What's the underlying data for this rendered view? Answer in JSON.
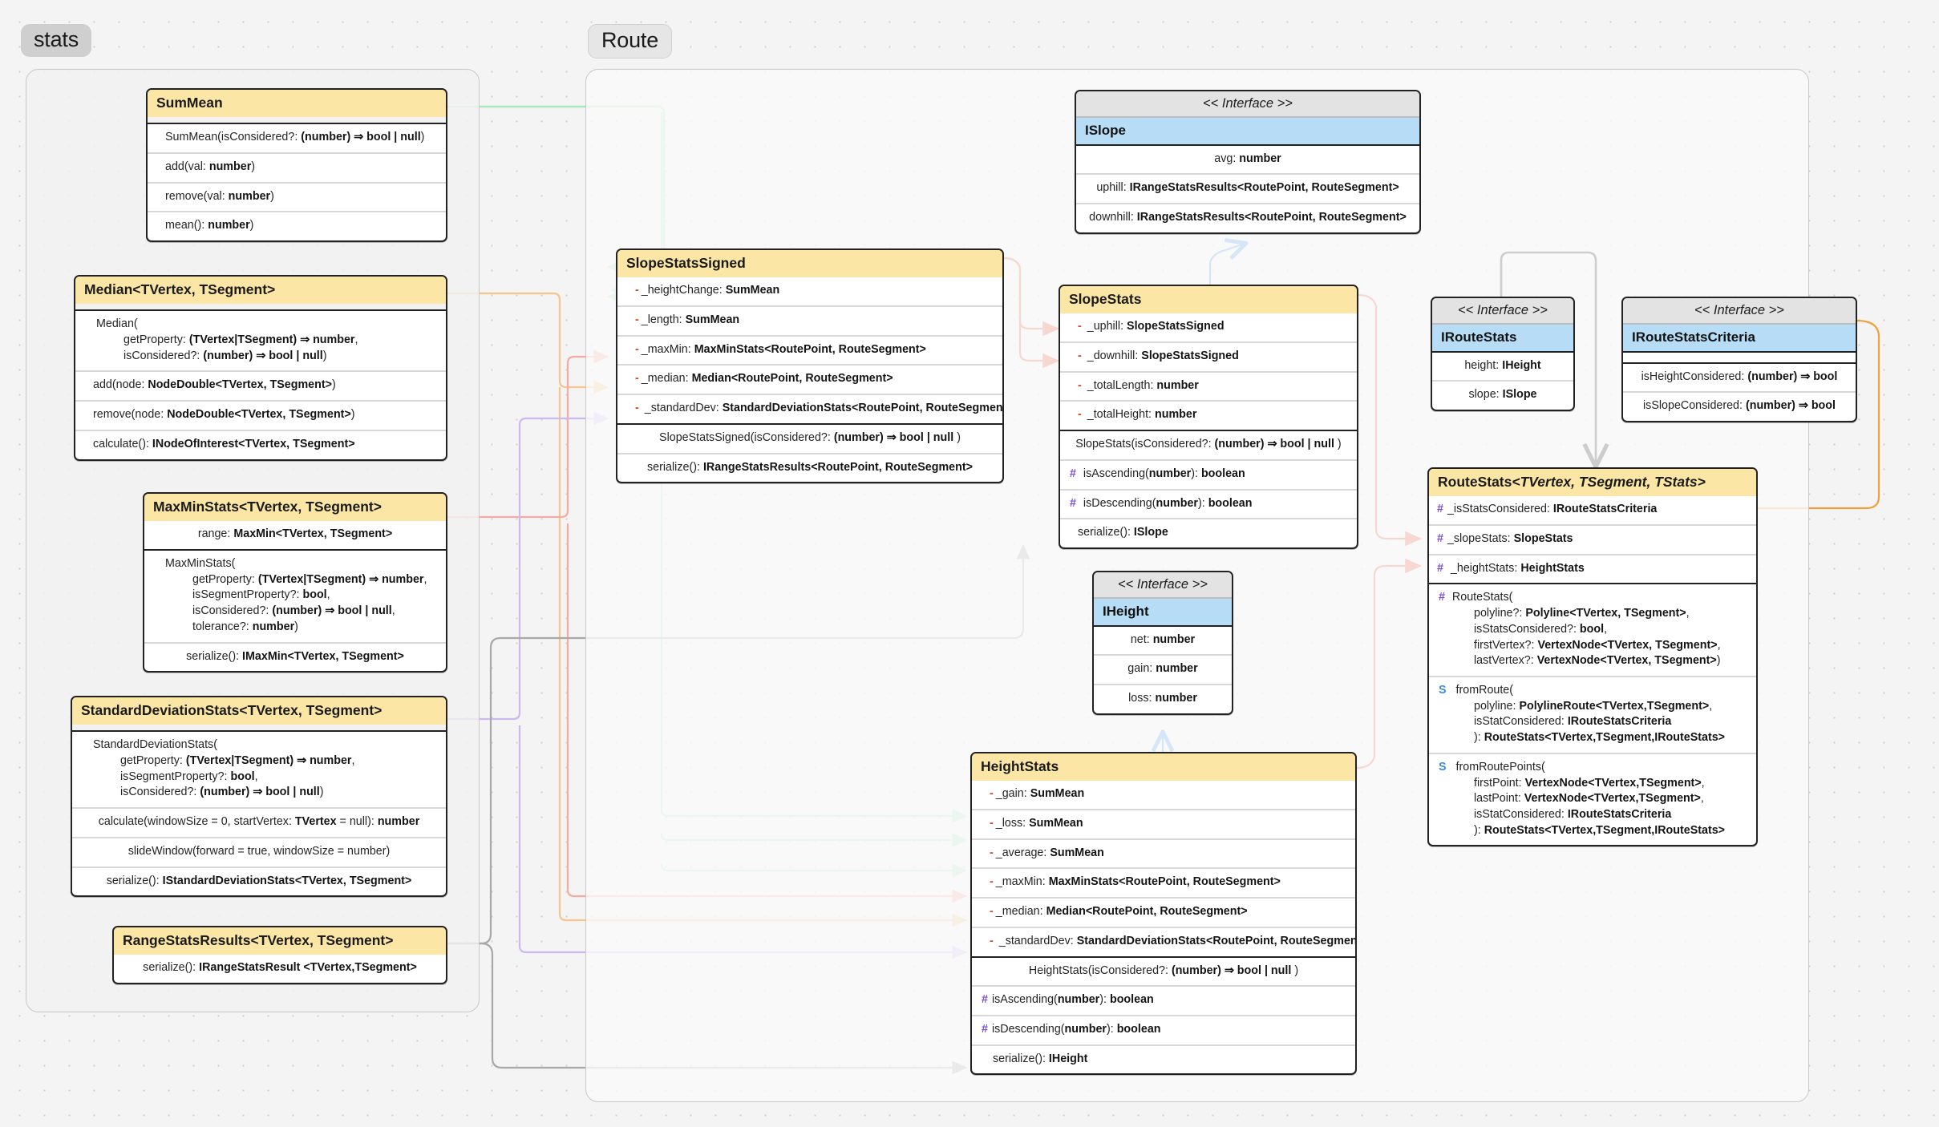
{
  "packages": [
    {
      "label": "stats"
    },
    {
      "label": "Route"
    }
  ],
  "colors": {
    "class_header": "#fbe6a5",
    "interface_header": "#b6dcf6",
    "stereotype_bg": "#e3e3e3",
    "wire_green": "#a8e6bf",
    "wire_orange_pastel": "#f6c58b",
    "wire_salmon": "#f5aba1",
    "wire_purple": "#cbb9f2",
    "wire_gray": "#a8a8a8",
    "wire_red": "#e8502a",
    "wire_orange": "#f2a03c",
    "wire_blue": "#3f95e8",
    "visibility_private": "#d24a2a",
    "visibility_protected": "#7c4dd6",
    "visibility_static": "#3b8ae8"
  },
  "stereotype_label": "<< Interface >>",
  "classes": {
    "sum_mean": {
      "name": "SumMean",
      "attributes": [],
      "methods": [
        "SumMean(isConsidered?: (number) ⇒ bool | null)",
        "add(val: number)",
        "remove(val: number)",
        "mean(): number"
      ]
    },
    "median": {
      "name": "Median<TVertex, TSegment>",
      "attributes": [],
      "methods": [
        "Median( getProperty: (TVertex|TSegment) ⇒ number, isConsidered?: (number) ⇒ bool | null)",
        "add(node: NodeDouble<TVertex, TSegment>)",
        "remove(node: NodeDouble<TVertex, TSegment>)",
        "calculate(): INodeOfInterest<TVertex, TSegment>"
      ]
    },
    "max_min_stats": {
      "name": "MaxMinStats<TVertex, TSegment>",
      "attributes": [
        "range: MaxMin<TVertex, TSegment>"
      ],
      "methods": [
        "MaxMinStats( getProperty: (TVertex|TSegment) ⇒ number, isSegmentProperty?: bool, isConsidered?: (number) ⇒ bool | null, tolerance?: number)",
        "serialize(): IMaxMin<TVertex, TSegment>"
      ]
    },
    "standard_deviation_stats": {
      "name": "StandardDeviationStats<TVertex, TSegment>",
      "attributes": [],
      "methods": [
        "StandardDeviationStats( getProperty: (TVertex|TSegment) ⇒ number, isSegmentProperty?: bool, isConsidered?: (number) ⇒ bool | null)",
        "calculate(windowSize = 0, startVertex: TVertex = null): number",
        "slideWindow(forward = true, windowSize = number)",
        "serialize(): IStandardDeviationStats<TVertex, TSegment>"
      ]
    },
    "range_stats_results": {
      "name": "RangeStatsResults<TVertex, TSegment>",
      "attributes": [],
      "methods": [
        "serialize(): IRangeStatsResult <TVertex,TSegment>"
      ]
    },
    "slope_stats_signed": {
      "name": "SlopeStatsSigned",
      "attributes": [
        "_heightChange: SumMean",
        "_length: SumMean",
        "_maxMin: MaxMinStats<RoutePoint, RouteSegment>",
        "_median: Median<RoutePoint, RouteSegment>",
        "_standardDev: StandardDeviationStats<RoutePoint, RouteSegment>"
      ],
      "methods": [
        "SlopeStatsSigned(isConsidered?: (number) ⇒ bool | null )",
        "serialize(): IRangeStatsResults<RoutePoint, RouteSegment>"
      ]
    },
    "slope_stats": {
      "name": "SlopeStats",
      "attributes": [
        "_uphill: SlopeStatsSigned",
        "_downhill: SlopeStatsSigned",
        "_totalLength: number",
        "_totalHeight: number"
      ],
      "methods": [
        "SlopeStats(isConsidered?: (number) ⇒ bool | null )",
        "isAscending(number): boolean",
        "isDescending(number): boolean",
        "serialize(): ISlope"
      ]
    },
    "height_stats": {
      "name": "HeightStats",
      "attributes": [
        "_gain: SumMean",
        "_loss: SumMean",
        "_average: SumMean",
        "_maxMin: MaxMinStats<RoutePoint, RouteSegment>",
        "_median: Median<RoutePoint, RouteSegment>",
        "_standardDev: StandardDeviationStats<RoutePoint, RouteSegment>"
      ],
      "methods": [
        "HeightStats(isConsidered?: (number) ⇒ bool | null )",
        "isAscending(number): boolean",
        "isDescending(number): boolean",
        "serialize(): IHeight"
      ]
    },
    "route_stats": {
      "name": "RouteStats<TVertex, TSegment, TStats>",
      "attributes": [
        "_isStatsConsidered: IRouteStatsCriteria",
        "_slopeStats: SlopeStats",
        "_heightStats: HeightStats"
      ],
      "methods": [
        "RouteStats( polyline?: Polyline<TVertex, TSegment>, isStatsConsidered?: bool, firstVertex?: VertexNode<TVertex, TSegment>, lastVertex?: VertexNode<TVertex, TSegment>)",
        "fromRoute( polyline: PolylineRoute<TVertex,TSegment>, isStatConsidered: IRouteStatsCriteria ): RouteStats<TVertex,TSegment,IRouteStats>",
        "fromRoutePoints( firstPoint: VertexNode<TVertex,TSegment>, lastPoint: VertexNode<TVertex,TSegment>, isStatConsidered: IRouteStatsCriteria ): RouteStats<TVertex,TSegment,IRouteStats>"
      ]
    }
  },
  "interfaces": {
    "islope": {
      "stereotype": "<< Interface >>",
      "name": "ISlope",
      "members": [
        "avg: number",
        "uphill: IRangeStatsResults<RoutePoint, RouteSegment>",
        "downhill: IRangeStatsResults<RoutePoint, RouteSegment>"
      ]
    },
    "iheight": {
      "stereotype": "<< Interface >>",
      "name": "IHeight",
      "members": [
        "net: number",
        "gain: number",
        "loss: number"
      ]
    },
    "iroute_stats": {
      "stereotype": "<< Interface >>",
      "name": "IRouteStats",
      "members": [
        "height: IHeight",
        "slope: ISlope"
      ]
    },
    "iroute_stats_criteria": {
      "stereotype": "<< Interface >>",
      "name": "IRouteStatsCriteria",
      "members": [
        "isHeightConsidered: (number) ⇒ bool",
        "isSlopeConsidered: (number) ⇒ bool"
      ]
    }
  },
  "labels": {
    "sum_mean_title": "SumMean",
    "sum_mean_m0": "SumMean(isConsidered?: ",
    "sum_mean_m0b": "(number) ⇒ bool | null",
    "sum_mean_m0c": ")",
    "sum_mean_m1a": "add(val: ",
    "sum_mean_m1b": "number",
    "sum_mean_m1c": ")",
    "sum_mean_m2a": "remove(val: ",
    "sum_mean_m2b": "number",
    "sum_mean_m2c": ")",
    "sum_mean_m3a": "mean(): ",
    "sum_mean_m3b": "number"
  }
}
